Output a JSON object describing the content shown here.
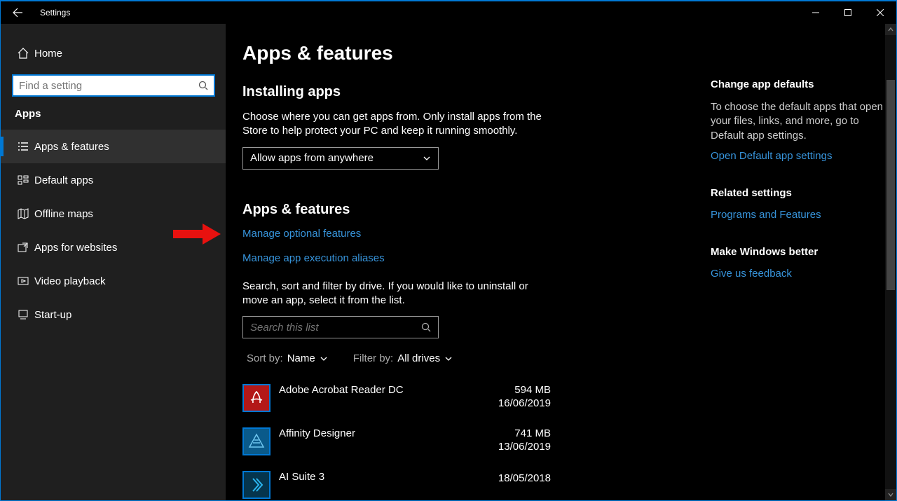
{
  "window": {
    "title": "Settings"
  },
  "sidebar": {
    "home_label": "Home",
    "search_placeholder": "Find a setting",
    "section_label": "Apps",
    "items": [
      {
        "label": "Apps & features",
        "icon": "list-icon",
        "active": true
      },
      {
        "label": "Default apps",
        "icon": "defaults-icon",
        "active": false
      },
      {
        "label": "Offline maps",
        "icon": "map-icon",
        "active": false
      },
      {
        "label": "Apps for websites",
        "icon": "web-open-icon",
        "active": false
      },
      {
        "label": "Video playback",
        "icon": "video-icon",
        "active": false
      },
      {
        "label": "Start-up",
        "icon": "startup-icon",
        "active": false
      }
    ]
  },
  "content": {
    "page_title": "Apps & features",
    "installing_heading": "Installing apps",
    "installing_text": "Choose where you can get apps from. Only install apps from the Store to help protect your PC and keep it running smoothly.",
    "source_dropdown": "Allow apps from anywhere",
    "apps_heading": "Apps & features",
    "manage_optional_link": "Manage optional features",
    "manage_aliases_link": "Manage app execution aliases",
    "search_sort_text": "Search, sort and filter by drive. If you would like to uninstall or move an app, select it from the list.",
    "search_list_placeholder": "Search this list",
    "sort_label": "Sort by:",
    "sort_value": "Name",
    "filter_label": "Filter by:",
    "filter_value": "All drives",
    "apps": [
      {
        "name": "Adobe Acrobat Reader DC",
        "size": "594 MB",
        "date": "16/06/2019",
        "icon_bg": "#b31818",
        "icon_fg": "#fff",
        "glyph": "acrobat"
      },
      {
        "name": "Affinity Designer",
        "size": "741 MB",
        "date": "13/06/2019",
        "icon_bg": "#0a5a8a",
        "icon_fg": "#6ec6ef",
        "glyph": "affinity"
      },
      {
        "name": "AI Suite 3",
        "size": "",
        "date": "18/05/2018",
        "icon_bg": "#0a4a6a",
        "icon_fg": "#2bb6f0",
        "glyph": "ai"
      }
    ]
  },
  "right": {
    "defaults_heading": "Change app defaults",
    "defaults_text": "To choose the default apps that open your files, links, and more, go to Default app settings.",
    "defaults_link": "Open Default app settings",
    "related_heading": "Related settings",
    "related_link": "Programs and Features",
    "better_heading": "Make Windows better",
    "better_link": "Give us feedback"
  }
}
